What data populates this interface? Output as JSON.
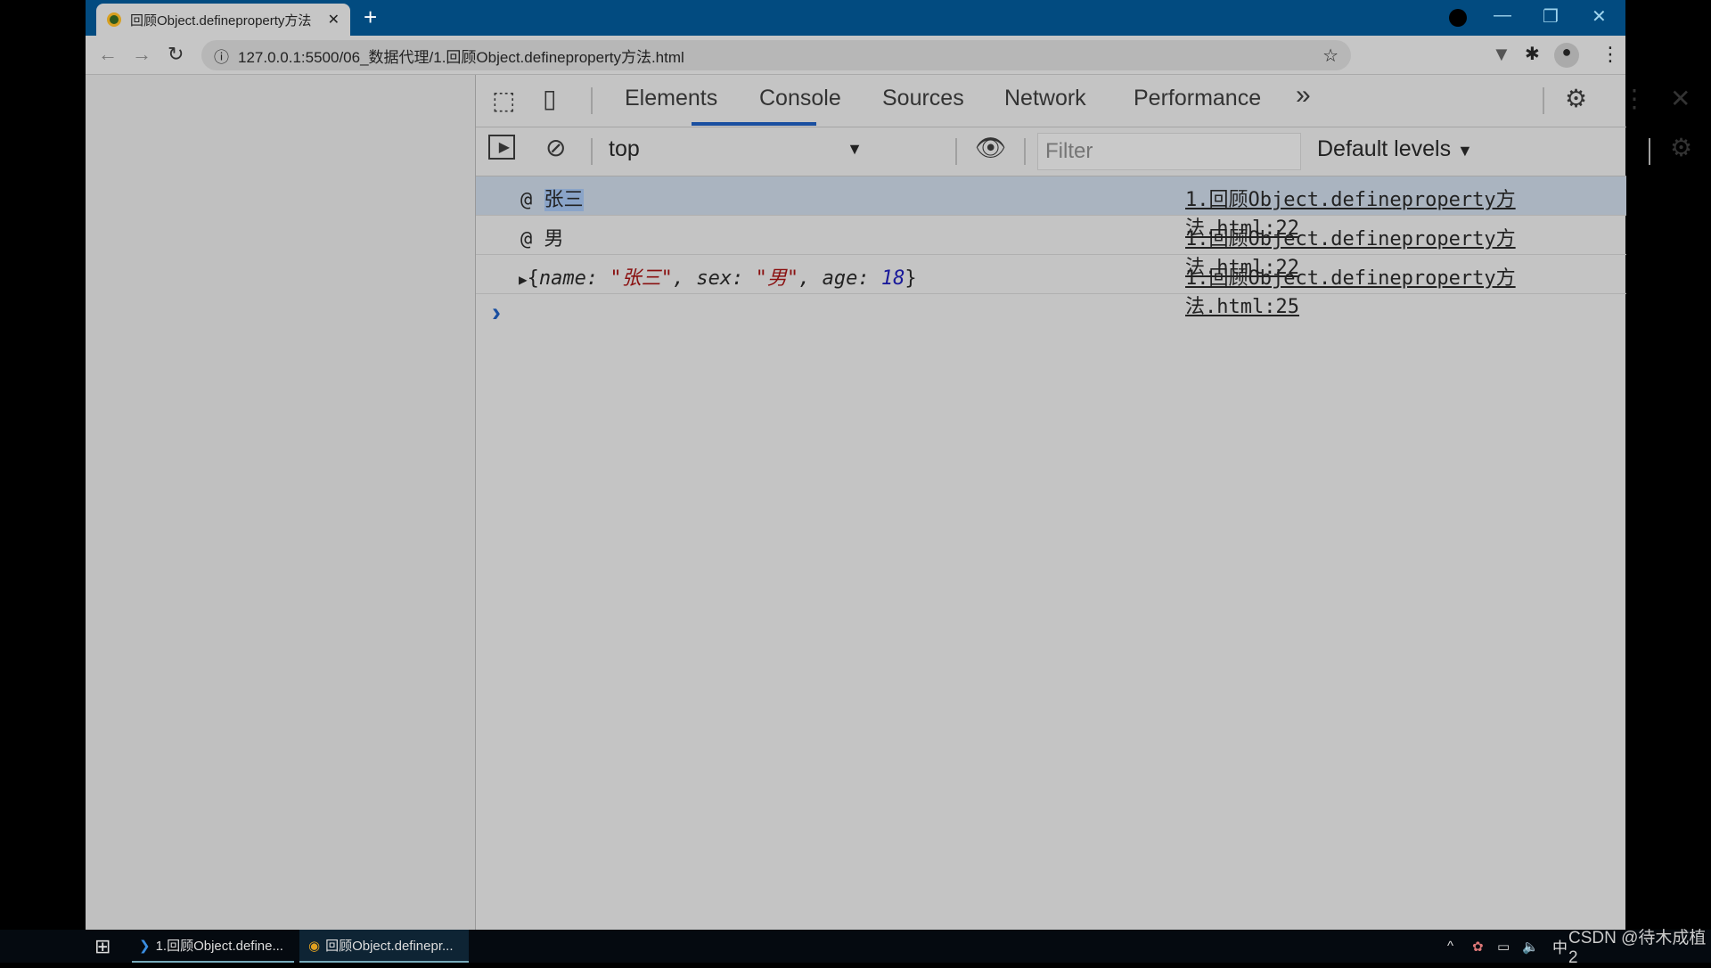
{
  "browser": {
    "tab_title": "回顾Object.defineproperty方法",
    "url": "127.0.0.1:5500/06_数据代理/1.回顾Object.defineproperty方法.html"
  },
  "devtools": {
    "tabs": [
      "Elements",
      "Console",
      "Sources",
      "Network",
      "Performance"
    ],
    "active_tab": "Console",
    "more_tabs": "»",
    "context": "top",
    "filter_placeholder": "Filter",
    "levels": "Default levels",
    "accent": "#1a4fa0"
  },
  "console": {
    "rows": [
      {
        "prefix": "@",
        "value": "张三",
        "source": "1.回顾Object.defineproperty方法.html:22",
        "selected": true
      },
      {
        "prefix": "@",
        "value": "男",
        "source": "1.回顾Object.defineproperty方法.html:22"
      },
      {
        "object": {
          "open": "{",
          "k1": "name: ",
          "v1": "\"张三\"",
          "c1": ", ",
          "k2": "sex: ",
          "v2": "\"男\"",
          "c2": ", ",
          "k3": "age: ",
          "v3": "18",
          "close": "}"
        },
        "source": "1.回顾Object.defineproperty方法.html:25"
      }
    ],
    "prompt": "›"
  },
  "taskbar": {
    "items": [
      "1.回顾Object.define...",
      "回顾Object.definepr..."
    ],
    "tray_text": "中",
    "watermark": "CSDN @待木成植2"
  }
}
